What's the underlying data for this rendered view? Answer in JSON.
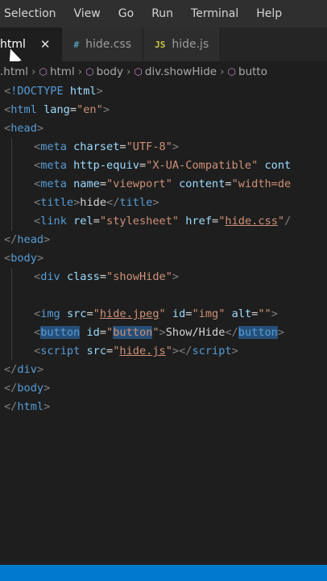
{
  "menubar": {
    "items": [
      "Selection",
      "View",
      "Go",
      "Run",
      "Terminal",
      "Help"
    ]
  },
  "tabs": [
    {
      "label": "html",
      "icon": "",
      "active": true
    },
    {
      "label": "hide.css",
      "icon": "#",
      "active": false
    },
    {
      "label": "hide.js",
      "icon": "JS",
      "active": false
    }
  ],
  "breadcrumb": [
    ".html",
    "html",
    "body",
    "div.showHide",
    "butto"
  ],
  "code": {
    "doctype": "!DOCTYPE",
    "html_kw": "html",
    "html_tag": "html",
    "lang_attr": "lang",
    "lang_val": "\"en\"",
    "head_tag": "head",
    "meta_tag": "meta",
    "charset_attr": "charset",
    "charset_val": "\"UTF-8\"",
    "http_equiv_attr": "http-equiv",
    "http_equiv_val": "\"X-UA-Compatible\"",
    "content_attr_trunc": "cont",
    "name_attr": "name",
    "name_val": "\"viewport\"",
    "content_attr": "content",
    "content_val_trunc": "\"width=de",
    "title_tag": "title",
    "title_text": "hide",
    "link_tag": "link",
    "rel_attr": "rel",
    "rel_val": "\"stylesheet\"",
    "href_attr": "href",
    "href_q1": "\"",
    "href_file": "hide.css",
    "href_q2": "\"",
    "body_tag": "body",
    "div_tag": "div",
    "class_attr": "class",
    "class_val": "\"showHide\"",
    "img_tag": "img",
    "src_attr": "src",
    "img_q1": "\"",
    "img_file": "hide.jpeg",
    "img_q2": "\"",
    "id_attr": "id",
    "img_id_val": "\"img\"",
    "alt_attr": "alt",
    "alt_val": "\"\"",
    "button_tag": "button",
    "button_id_q1": "\"",
    "button_id_val": "button",
    "button_id_q2": "\"",
    "button_text": "Show/Hide",
    "script_tag": "script",
    "js_q1": "\"",
    "js_file": "hide.js",
    "js_q2": "\""
  },
  "colors": {
    "editor_bg": "#1e1e1e",
    "menubar_bg": "#2f2f30",
    "tag_blue": "#569cd6",
    "attr_lightblue": "#9cdcfe",
    "string_orange": "#ce9178",
    "statusbar_blue": "#007acc"
  }
}
